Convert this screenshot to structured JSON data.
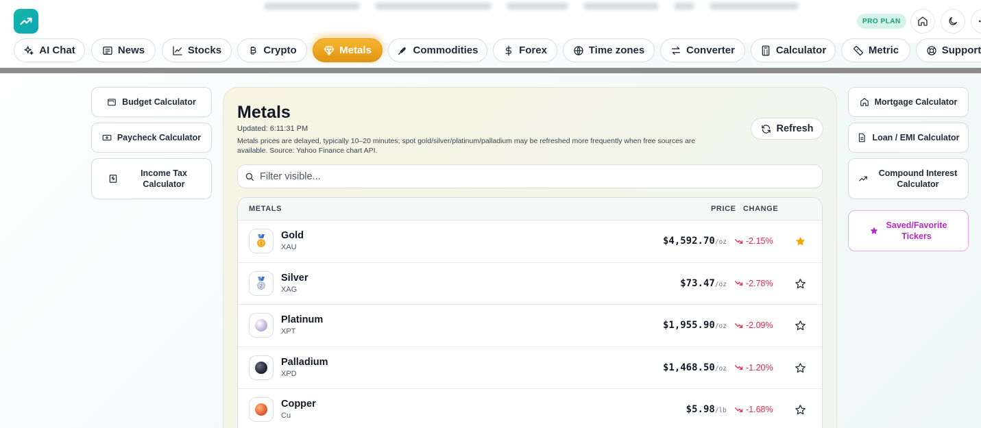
{
  "header": {
    "badge": "PRO PLAN"
  },
  "nav": [
    {
      "label": "AI Chat",
      "icon": "sparkles-icon"
    },
    {
      "label": "News",
      "icon": "newspaper-icon"
    },
    {
      "label": "Stocks",
      "icon": "chart-line-icon"
    },
    {
      "label": "Crypto",
      "icon": "bitcoin-icon"
    },
    {
      "label": "Metals",
      "icon": "gem-icon",
      "active": true
    },
    {
      "label": "Commodities",
      "icon": "wheat-icon"
    },
    {
      "label": "Forex",
      "icon": "dollar-icon"
    },
    {
      "label": "Time zones",
      "icon": "globe-icon"
    },
    {
      "label": "Converter",
      "icon": "arrows-icon"
    },
    {
      "label": "Calculator",
      "icon": "calculator-icon"
    },
    {
      "label": "Metric",
      "icon": "ruler-icon"
    },
    {
      "label": "Support",
      "icon": "lifebuoy-icon"
    }
  ],
  "left_tools": [
    "Budget Calculator",
    "Paycheck Calculator",
    "Income Tax Calculator"
  ],
  "right_tools": [
    "Mortgage Calculator",
    "Loan / EMI Calculator",
    "Compound Interest Calculator",
    "Saved/Favorite Tickers"
  ],
  "panel": {
    "title": "Metals",
    "updated": "Updated: 6:11:31 PM",
    "note": "Metals prices are delayed, typically 10–20 minutes; spot gold/silver/platinum/palladium may be refreshed more frequently when free sources are available. Source: Yahoo Finance chart API.",
    "refresh_label": "Refresh",
    "filter_placeholder": "Filter visible...",
    "columns": {
      "metals": "METALS",
      "price": "PRICE",
      "change": "CHANGE"
    },
    "rows": [
      {
        "name": "Gold",
        "symbol": "XAU",
        "price": "$4,592.70",
        "unit": "/oz",
        "change": "-2.15%",
        "favorite": true
      },
      {
        "name": "Silver",
        "symbol": "XAG",
        "price": "$73.47",
        "unit": "/oz",
        "change": "-2.78%",
        "favorite": false
      },
      {
        "name": "Platinum",
        "symbol": "XPT",
        "price": "$1,955.90",
        "unit": "/oz",
        "change": "-2.09%",
        "favorite": false
      },
      {
        "name": "Palladium",
        "symbol": "XPD",
        "price": "$1,468.50",
        "unit": "/oz",
        "change": "-1.20%",
        "favorite": false
      },
      {
        "name": "Copper",
        "symbol": "Cu",
        "price": "$5.98",
        "unit": "/lb",
        "change": "-1.68%",
        "favorite": false
      }
    ]
  },
  "colors": {
    "accent": "#14b8a6",
    "active_tab": "#f0a623",
    "negative": "#e0284a",
    "favorite_star": "#f5a30c",
    "favorites_accent": "#b32bc0"
  }
}
